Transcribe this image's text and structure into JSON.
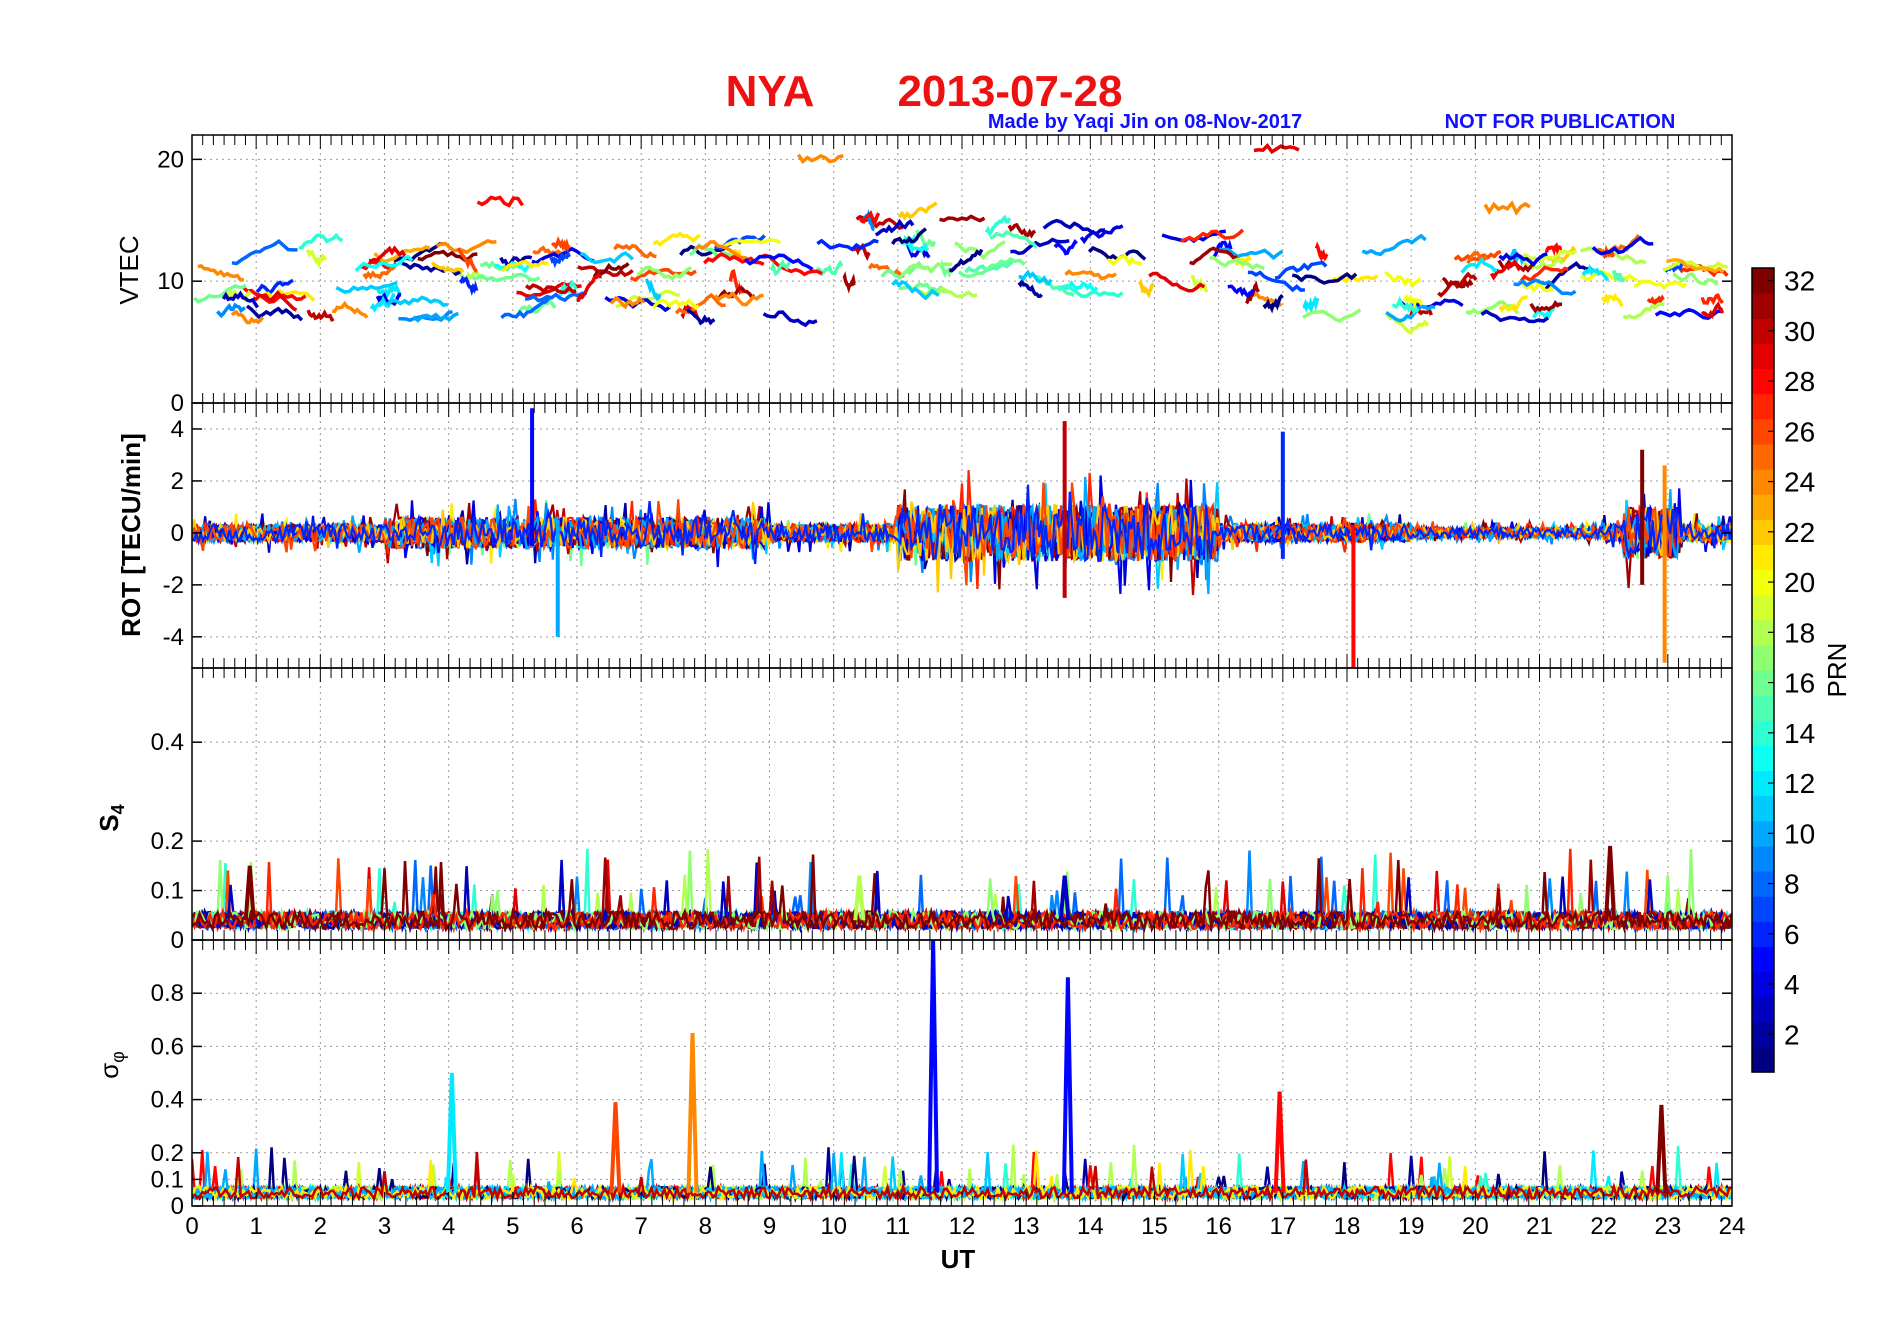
{
  "header": {
    "station": "NYA",
    "date": "2013-07-28",
    "credit": "Made by Yaqi Jin on 08-Nov-2017",
    "notice": "NOT FOR PUBLICATION",
    "title_color": "#ee1111",
    "note_color": "#1010ff"
  },
  "chart_data": {
    "type": "line",
    "x_label": "UT",
    "xlim": [
      0,
      24
    ],
    "x_ticks": [
      "0",
      "1",
      "2",
      "3",
      "4",
      "5",
      "6",
      "7",
      "8",
      "9",
      "10",
      "11",
      "12",
      "13",
      "14",
      "15",
      "16",
      "17",
      "18",
      "19",
      "20",
      "21",
      "22",
      "23",
      "24"
    ],
    "colorbar": {
      "label": "PRN",
      "range": [
        1,
        32
      ],
      "ticks": [
        "2",
        "4",
        "6",
        "8",
        "10",
        "12",
        "14",
        "16",
        "18",
        "20",
        "22",
        "24",
        "26",
        "28",
        "30",
        "32"
      ],
      "colormap": "jet"
    },
    "panels": [
      {
        "key": "vtec",
        "ylabel": "VTEC",
        "ylim": [
          0,
          22
        ],
        "y_ticks": [
          "0",
          "10",
          "20"
        ],
        "typical_level": 10,
        "features": [
          {
            "x": 9.8,
            "y": 20,
            "prn": 24
          },
          {
            "x": 12.0,
            "y": 15,
            "prn": 31
          },
          {
            "x": 16.9,
            "y": 21,
            "prn": 29
          },
          {
            "x": 20.5,
            "y": 16,
            "prn": 24
          },
          {
            "x": 4.8,
            "y": 16.5,
            "prn": 28
          },
          {
            "x": 3.8,
            "y": 7,
            "prn": 10
          }
        ]
      },
      {
        "key": "rot",
        "ylabel": "ROT [TECU/min]",
        "ylim": [
          -5.2,
          5
        ],
        "y_ticks": [
          "4",
          "2",
          "0",
          "-2",
          "-4"
        ],
        "spikes": [
          {
            "x": 5.3,
            "min": -0.5,
            "max": 4.8,
            "prn": 5
          },
          {
            "x": 5.7,
            "min": -4.0,
            "max": 0.5,
            "prn": 10
          },
          {
            "x": 13.6,
            "min": -2.5,
            "max": 4.3,
            "prn": 30
          },
          {
            "x": 17.0,
            "min": -1.0,
            "max": 3.9,
            "prn": 6
          },
          {
            "x": 18.1,
            "min": -5.2,
            "max": 0.3,
            "prn": 28
          },
          {
            "x": 22.6,
            "min": -2.0,
            "max": 3.2,
            "prn": 32
          },
          {
            "x": 22.95,
            "min": -5.0,
            "max": 2.6,
            "prn": 24
          }
        ]
      },
      {
        "key": "s4",
        "ylabel": "S4",
        "ylim": [
          0,
          0.55
        ],
        "y_ticks": [
          "0",
          "0.1",
          "0.2",
          "0.4"
        ],
        "typical_level": 0.04,
        "spikes": [
          {
            "x": 0.9,
            "value": 0.15,
            "prn": 32
          },
          {
            "x": 13.6,
            "value": 0.13,
            "prn": 3
          },
          {
            "x": 22.1,
            "value": 0.19,
            "prn": 32
          },
          {
            "x": 10.4,
            "value": 0.13,
            "prn": 18
          }
        ]
      },
      {
        "key": "sigma_phi",
        "ylabel": "σφ",
        "ylim": [
          0,
          1.0
        ],
        "y_ticks": [
          "0",
          "0.1",
          "0.2",
          "0.4",
          "0.6",
          "0.8"
        ],
        "typical_level": 0.05,
        "spikes": [
          {
            "x": 4.05,
            "value": 0.5,
            "prn": 12
          },
          {
            "x": 7.8,
            "value": 0.65,
            "prn": 24
          },
          {
            "x": 11.55,
            "value": 1.0,
            "prn": 5
          },
          {
            "x": 13.65,
            "value": 0.86,
            "prn": 5
          },
          {
            "x": 16.95,
            "value": 0.43,
            "prn": 28
          },
          {
            "x": 6.6,
            "value": 0.39,
            "prn": 26
          },
          {
            "x": 22.9,
            "value": 0.38,
            "prn": 32
          }
        ]
      }
    ]
  }
}
